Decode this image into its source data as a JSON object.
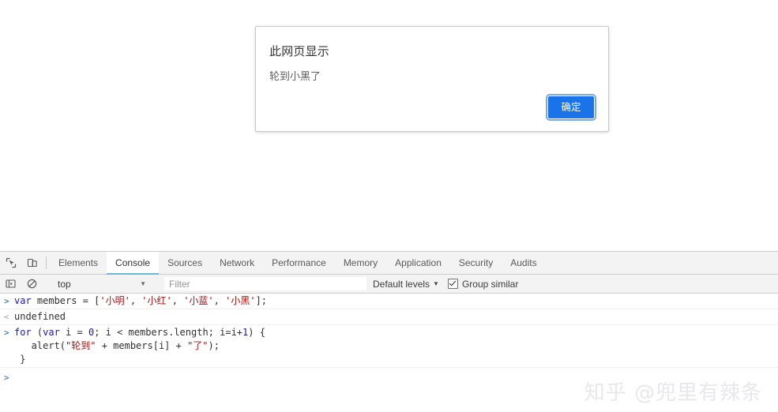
{
  "dialog": {
    "title": "此网页显示",
    "message": "轮到小黑了",
    "ok_label": "确定",
    "accent_color": "#1a73e8"
  },
  "devtools": {
    "icons": {
      "inspect": "inspect-element-icon",
      "device": "device-toolbar-icon",
      "sidebar": "console-sidebar-icon",
      "clear": "clear-console-icon"
    },
    "tabs": [
      {
        "label": "Elements",
        "active": false
      },
      {
        "label": "Console",
        "active": true
      },
      {
        "label": "Sources",
        "active": false
      },
      {
        "label": "Network",
        "active": false
      },
      {
        "label": "Performance",
        "active": false
      },
      {
        "label": "Memory",
        "active": false
      },
      {
        "label": "Application",
        "active": false
      },
      {
        "label": "Security",
        "active": false
      },
      {
        "label": "Audits",
        "active": false
      }
    ],
    "filterbar": {
      "context": "top",
      "filter_placeholder": "Filter",
      "filter_value": "",
      "levels_label": "Default levels",
      "group_similar_label": "Group similar",
      "group_similar_checked": true,
      "caret": "▼"
    },
    "console": {
      "input_arrow": ">",
      "output_arrow": "<",
      "rows": [
        {
          "kind": "input",
          "lines": [
            [
              {
                "t": "var ",
                "c": "kw"
              },
              {
                "t": "members = [",
                "c": "plain"
              },
              {
                "t": "'小明'",
                "c": "str"
              },
              {
                "t": ", ",
                "c": "plain"
              },
              {
                "t": "'小红'",
                "c": "str"
              },
              {
                "t": ", ",
                "c": "plain"
              },
              {
                "t": "'小蓝'",
                "c": "str"
              },
              {
                "t": ", ",
                "c": "plain"
              },
              {
                "t": "'小黑'",
                "c": "str"
              },
              {
                "t": "];",
                "c": "plain"
              }
            ]
          ]
        },
        {
          "kind": "output",
          "lines": [
            [
              {
                "t": "undefined",
                "c": "plain"
              }
            ]
          ]
        },
        {
          "kind": "input",
          "lines": [
            [
              {
                "t": "for ",
                "c": "kw"
              },
              {
                "t": "(",
                "c": "plain"
              },
              {
                "t": "var ",
                "c": "kw"
              },
              {
                "t": "i = ",
                "c": "plain"
              },
              {
                "t": "0",
                "c": "num"
              },
              {
                "t": "; i < members.length; i=i+",
                "c": "plain"
              },
              {
                "t": "1",
                "c": "num"
              },
              {
                "t": ") {",
                "c": "plain"
              }
            ],
            [
              {
                "t": "   alert(",
                "c": "plain"
              },
              {
                "t": "\"轮到\"",
                "c": "str"
              },
              {
                "t": " + members[i] + ",
                "c": "plain"
              },
              {
                "t": "\"了\"",
                "c": "str"
              },
              {
                "t": ");",
                "c": "plain"
              }
            ],
            [
              {
                "t": " }",
                "c": "plain"
              }
            ]
          ]
        }
      ]
    }
  },
  "watermark": {
    "text": "知乎 @兜里有辣条"
  }
}
